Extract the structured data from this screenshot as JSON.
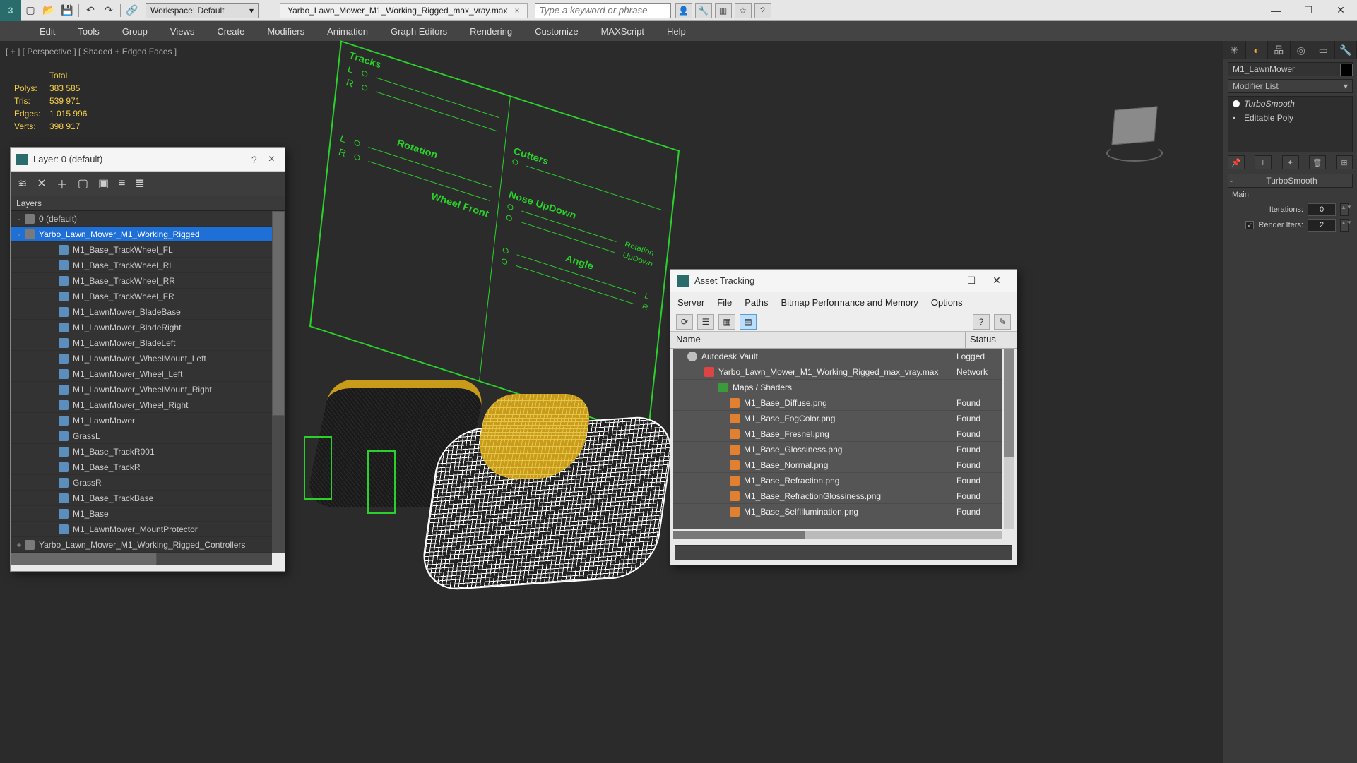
{
  "titlebar": {
    "workspace_label": "Workspace: Default",
    "filename": "Yarbo_Lawn_Mower_M1_Working_Rigged_max_vray.max",
    "search_placeholder": "Type a keyword or phrase"
  },
  "menubar": [
    "Edit",
    "Tools",
    "Group",
    "Views",
    "Create",
    "Modifiers",
    "Animation",
    "Graph Editors",
    "Rendering",
    "Customize",
    "MAXScript",
    "Help"
  ],
  "viewport": {
    "label": "[ + ] [ Perspective ] [ Shaded + Edged Faces ]",
    "stats": {
      "total_label": "Total",
      "polys_label": "Polys:",
      "polys": "383 585",
      "tris_label": "Tris:",
      "tris": "539 971",
      "edges_label": "Edges:",
      "edges": "1 015 996",
      "verts_label": "Verts:",
      "verts": "398 917"
    },
    "rig": {
      "tracks": "Tracks",
      "l": "L",
      "r": "R",
      "rotation": "Rotation",
      "wheel_front": "Wheel Front",
      "cutters": "Cutters",
      "nose": "Nose UpDown",
      "rot_r": "Rotation",
      "updown_r": "UpDown",
      "angle": "Angle"
    }
  },
  "cmdpanel": {
    "object_name": "M1_LawnMower",
    "modifier_list": "Modifier List",
    "stack": [
      "TurboSmooth",
      "Editable Poly"
    ],
    "rollout_title": "TurboSmooth",
    "main_label": "Main",
    "iterations_label": "Iterations:",
    "iterations": "0",
    "render_iters_label": "Render Iters:",
    "render_iters": "2"
  },
  "layer_dlg": {
    "title": "Layer: 0 (default)",
    "col": "Layers",
    "tree": [
      {
        "depth": 0,
        "label": "0 (default)",
        "grp": true,
        "exp": "-"
      },
      {
        "depth": 0,
        "label": "Yarbo_Lawn_Mower_M1_Working_Rigged",
        "grp": true,
        "sel": true,
        "exp": "-"
      },
      {
        "depth": 2,
        "label": "M1_Base_TrackWheel_FL"
      },
      {
        "depth": 2,
        "label": "M1_Base_TrackWheel_RL"
      },
      {
        "depth": 2,
        "label": "M1_Base_TrackWheel_RR"
      },
      {
        "depth": 2,
        "label": "M1_Base_TrackWheel_FR"
      },
      {
        "depth": 2,
        "label": "M1_LawnMower_BladeBase"
      },
      {
        "depth": 2,
        "label": "M1_LawnMower_BladeRight"
      },
      {
        "depth": 2,
        "label": "M1_LawnMower_BladeLeft"
      },
      {
        "depth": 2,
        "label": "M1_LawnMower_WheelMount_Left"
      },
      {
        "depth": 2,
        "label": "M1_LawnMower_Wheel_Left"
      },
      {
        "depth": 2,
        "label": "M1_LawnMower_WheelMount_Right"
      },
      {
        "depth": 2,
        "label": "M1_LawnMower_Wheel_Right"
      },
      {
        "depth": 2,
        "label": "M1_LawnMower"
      },
      {
        "depth": 2,
        "label": "GrassL"
      },
      {
        "depth": 2,
        "label": "M1_Base_TrackR001"
      },
      {
        "depth": 2,
        "label": "M1_Base_TrackR"
      },
      {
        "depth": 2,
        "label": "GrassR"
      },
      {
        "depth": 2,
        "label": "M1_Base_TrackBase"
      },
      {
        "depth": 2,
        "label": "M1_Base"
      },
      {
        "depth": 2,
        "label": "M1_LawnMower_MountProtector"
      },
      {
        "depth": 0,
        "label": "Yarbo_Lawn_Mower_M1_Working_Rigged_Controllers",
        "grp": true,
        "exp": "+"
      }
    ]
  },
  "asset_dlg": {
    "title": "Asset Tracking",
    "menu": [
      "Server",
      "File",
      "Paths",
      "Bitmap Performance and Memory",
      "Options"
    ],
    "col_name": "Name",
    "col_status": "Status",
    "rows": [
      {
        "depth": 0,
        "icon": "vault",
        "name": "Autodesk Vault",
        "status": "Logged"
      },
      {
        "depth": 1,
        "icon": "max",
        "name": "Yarbo_Lawn_Mower_M1_Working_Rigged_max_vray.max",
        "status": "Network"
      },
      {
        "depth": 2,
        "icon": "fold",
        "name": "Maps / Shaders",
        "status": ""
      },
      {
        "depth": 3,
        "icon": "png",
        "name": "M1_Base_Diffuse.png",
        "status": "Found"
      },
      {
        "depth": 3,
        "icon": "png",
        "name": "M1_Base_FogColor.png",
        "status": "Found"
      },
      {
        "depth": 3,
        "icon": "png",
        "name": "M1_Base_Fresnel.png",
        "status": "Found"
      },
      {
        "depth": 3,
        "icon": "png",
        "name": "M1_Base_Glossiness.png",
        "status": "Found"
      },
      {
        "depth": 3,
        "icon": "png",
        "name": "M1_Base_Normal.png",
        "status": "Found"
      },
      {
        "depth": 3,
        "icon": "png",
        "name": "M1_Base_Refraction.png",
        "status": "Found"
      },
      {
        "depth": 3,
        "icon": "png",
        "name": "M1_Base_RefractionGlossiness.png",
        "status": "Found"
      },
      {
        "depth": 3,
        "icon": "png",
        "name": "M1_Base_SelfIllumination.png",
        "status": "Found"
      }
    ]
  }
}
